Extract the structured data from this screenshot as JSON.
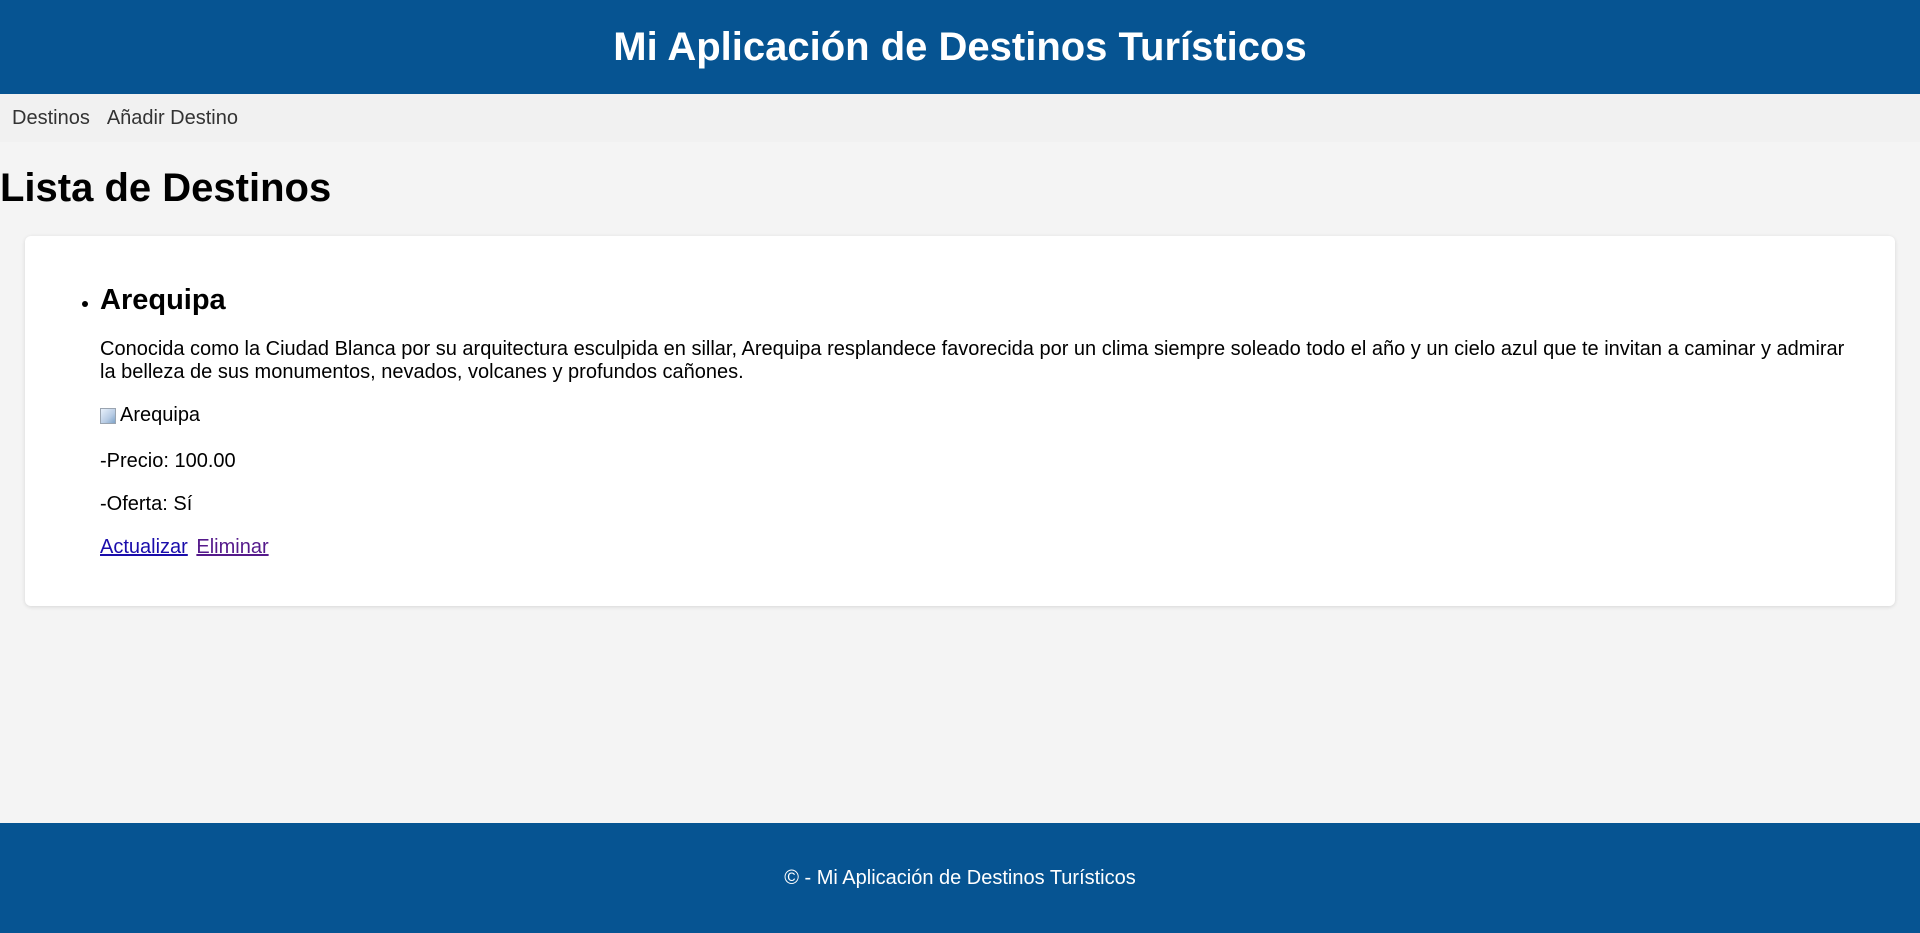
{
  "header": {
    "title": "Mi Aplicación de Destinos Turísticos"
  },
  "nav": {
    "items": [
      {
        "label": "Destinos"
      },
      {
        "label": "Añadir Destino"
      }
    ]
  },
  "main": {
    "title": "Lista de Destinos",
    "destinations": [
      {
        "name": "Arequipa",
        "description": "Conocida como la Ciudad Blanca por su arquitectura esculpida en sillar, Arequipa resplandece favorecida por un clima siempre soleado todo el año y un cielo azul que te invitan a caminar y admirar la belleza de sus monumentos, nevados, volcanes y profundos cañones.",
        "image_alt": "Arequipa",
        "price_text": "-Precio: 100.00",
        "offer_text": "-Oferta: Sí",
        "update_label": "Actualizar",
        "delete_label": "Eliminar"
      }
    ]
  },
  "footer": {
    "text": "© - Mi Aplicación de Destinos Turísticos"
  },
  "colors": {
    "brand": "#065492",
    "link": "#1a0dab",
    "visited_link": "#551a8b",
    "background": "#f4f4f4"
  }
}
